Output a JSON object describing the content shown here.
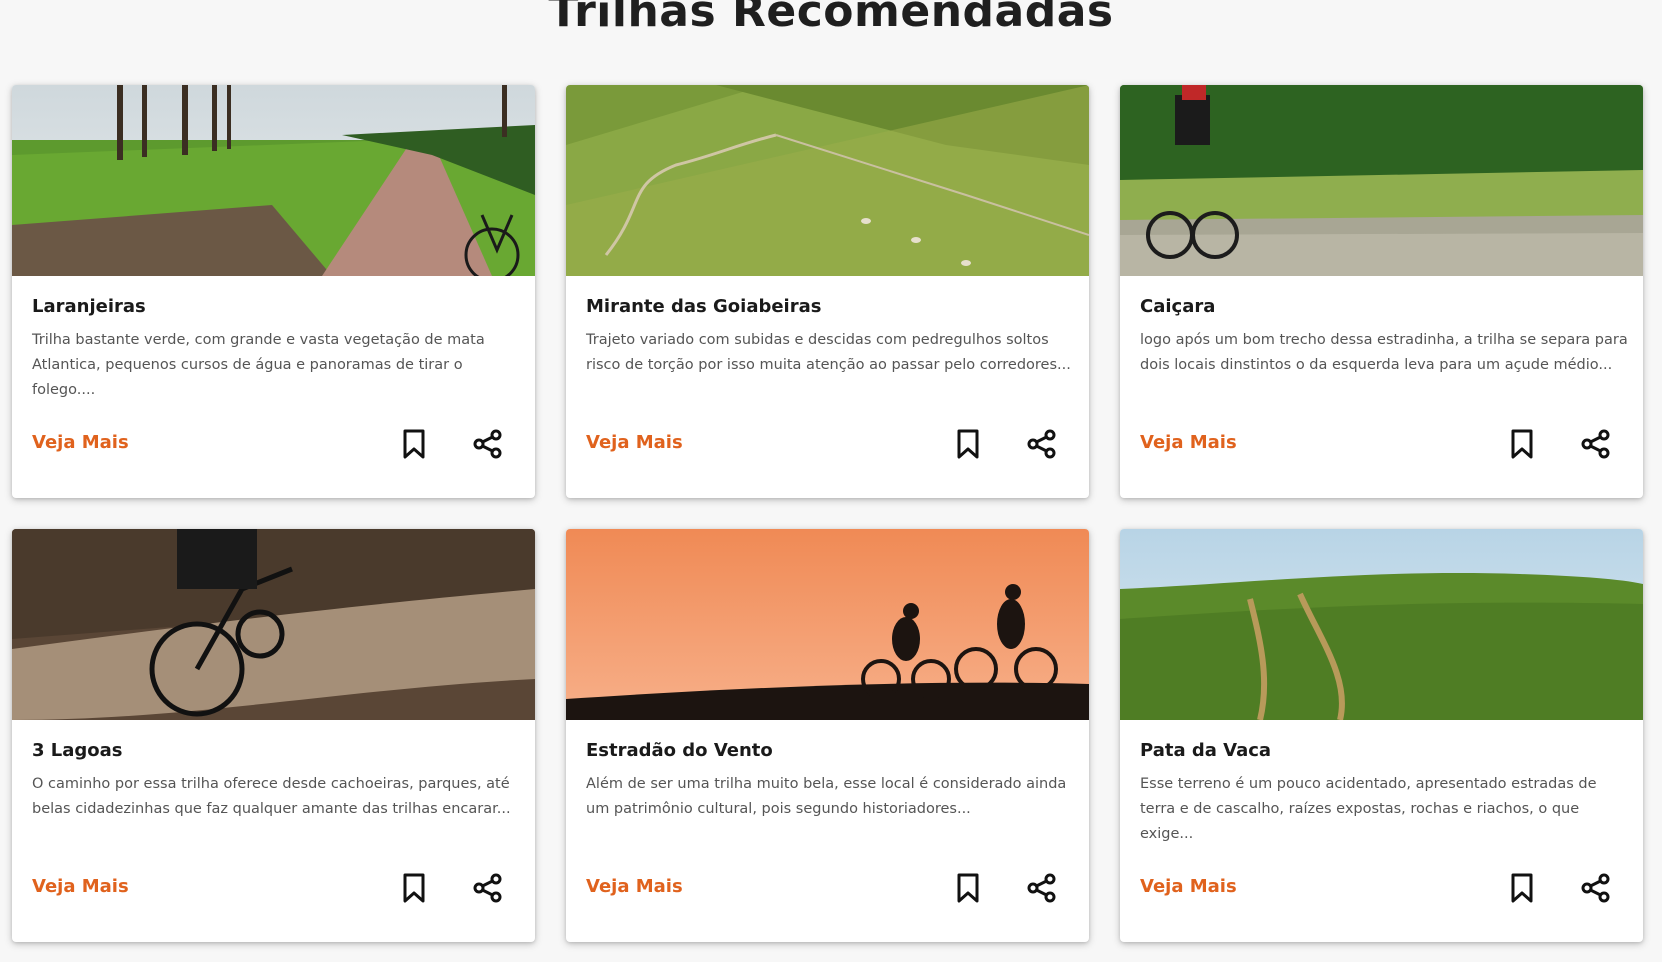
{
  "page": {
    "title": "Trilhas Recomendadas"
  },
  "colors": {
    "accent": "#e0621d",
    "title": "#1a1a1a",
    "text": "#555555",
    "card_bg": "#ffffff",
    "page_bg": "#f7f7f7"
  },
  "cards": [
    {
      "title": "Laranjeiras",
      "description": "Trilha bastante verde, com grande e vasta vegetação de mata Atlantica, pequenos cursos de água e panoramas de tirar o folego....",
      "cta": "Veja Mais",
      "bookmark_icon": "bookmark-icon",
      "share_icon": "share-icon"
    },
    {
      "title": "Mirante das Goiabeiras",
      "description": "Trajeto variado com subidas e descidas com pedregulhos soltos risco de torção por isso muita atenção ao passar pelo corredores...",
      "cta": "Veja Mais",
      "bookmark_icon": "bookmark-icon",
      "share_icon": "share-icon"
    },
    {
      "title": "Caiçara",
      "description": "logo após um bom trecho dessa estradinha, a trilha se separa para dois locais dinstintos o da esquerda leva para um açude médio...",
      "cta": "Veja Mais",
      "bookmark_icon": "bookmark-icon",
      "share_icon": "share-icon"
    },
    {
      "title": "3 Lagoas",
      "description": "O caminho por essa trilha oferece desde cachoeiras, parques, até belas cidadezinhas que faz qualquer amante das trilhas encarar...",
      "cta": "Veja Mais",
      "bookmark_icon": "bookmark-icon",
      "share_icon": "share-icon"
    },
    {
      "title": "Estradão do Vento",
      "description": "Além de ser uma trilha muito bela, esse local é considerado ainda um patrimônio cultural, pois segundo historiadores...",
      "cta": "Veja Mais",
      "bookmark_icon": "bookmark-icon",
      "share_icon": "share-icon"
    },
    {
      "title": "Pata da Vaca",
      "description": "Esse terreno é um pouco acidentado, apresentado estradas de terra e de cascalho, raízes expostas, rochas e riachos, o que exige...",
      "cta": "Veja Mais",
      "bookmark_icon": "bookmark-icon",
      "share_icon": "share-icon"
    }
  ]
}
